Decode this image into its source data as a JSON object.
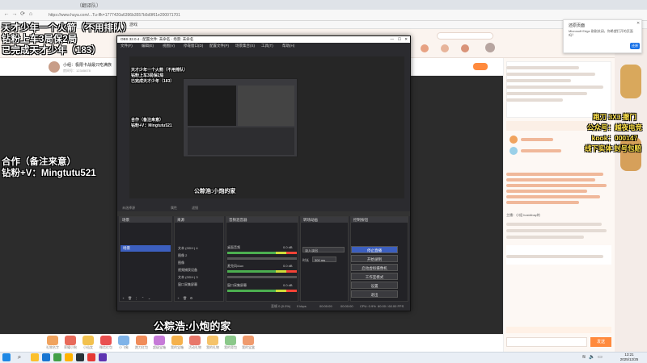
{
  "browser": {
    "tab_title": "（翻译队）",
    "url": "https://www.huya.com/...Tu-Ifk=1777420a6396b3557b5d9f61e200071701",
    "bookmark_item": "游戏",
    "search_placeholder": "立即搜索"
  },
  "notification": {
    "title": "还原页面",
    "body": "Microsoft Edge 刚刚关闭，你希望打开的页面吗？",
    "button": "还原"
  },
  "stream_overlay": {
    "line1": "天才少年一个火箭（不用排队）",
    "line2": "钻粉上车3局保2局",
    "line3": "已完成天才少年（183）",
    "coop1": "合作（备注来意）",
    "coop2": "钻粉+V：Mingtutu521",
    "bottom_banner": "公粽浩:小炮的家"
  },
  "promo": {
    "line1": "跑刀 3X3 撤门",
    "line2": "公众号：越夜电竞",
    "line3": "kook：000147",
    "line4": "线下实体 封号包赔"
  },
  "obs": {
    "title": "OBS 32.0.4 - 配置文件: 未命名 - 场景: 未命名",
    "menu": [
      "文件(F)",
      "编辑(E)",
      "视图(V)",
      "停靠窗口(D)",
      "配置文件(P)",
      "场景集合(S)",
      "工具(T)",
      "帮助(H)"
    ],
    "controls": [
      "未选择源",
      "属性",
      "滤镜"
    ],
    "scenes_title": "场景",
    "scene_item": "场景",
    "sources_title": "来源",
    "sources": [
      "文本 (GDI+) 4",
      "图像 2",
      "图像",
      "视频捕获设备",
      "文本 (GDI+) 3",
      "窗口采集屏幕"
    ],
    "mixer_title": "音频混音器",
    "mixer_tracks": [
      {
        "name": "桌面音频",
        "db": "0.0 dB"
      },
      {
        "name": "麦克风/Aux",
        "db": "0.0 dB"
      },
      {
        "name": "窗口采集屏幕",
        "db": "0.0 dB"
      }
    ],
    "transition_title": "转场动画",
    "transition_type": "淡入淡出",
    "transition_duration_label": "时长",
    "transition_duration": "300 ms",
    "controls_title": "控制按钮",
    "buttons": [
      "停止直播",
      "开始录制",
      "启动虚拟摄像机",
      "工作室模式",
      "设置",
      "退出"
    ],
    "status": {
      "dropped": "丢帧 0 (0.0%)",
      "bitrate": "0 kbps",
      "live_time": "00:00:09",
      "rec_time": "00:00:00",
      "cpu": "CPU: 0.9%",
      "fps": "60.00 / 60.00 FPS"
    }
  },
  "huya": {
    "streamer_name": "小组：极限卡战最只吃满族",
    "streamer_id": "房间号：12345678",
    "gift_labels": [
      "礼物名字",
      "荣耀小狗",
      "小仙女",
      "微信红包",
      "小飞象",
      "跑刀红包",
      "超级宝箱",
      "我的宝箱",
      "活动礼物",
      "我的礼物",
      "我的背包",
      "我的宝盒"
    ],
    "chat_announcement": "主播：小组 hostAbay的",
    "chat_send": "发送"
  },
  "taskbar": {
    "time": "13:21",
    "date": "2025/12/25"
  },
  "colors": {
    "obs_accent": "#3c5fbf",
    "promo_yellow": "#ffe34a",
    "edge_blue": "#1a73e8"
  }
}
